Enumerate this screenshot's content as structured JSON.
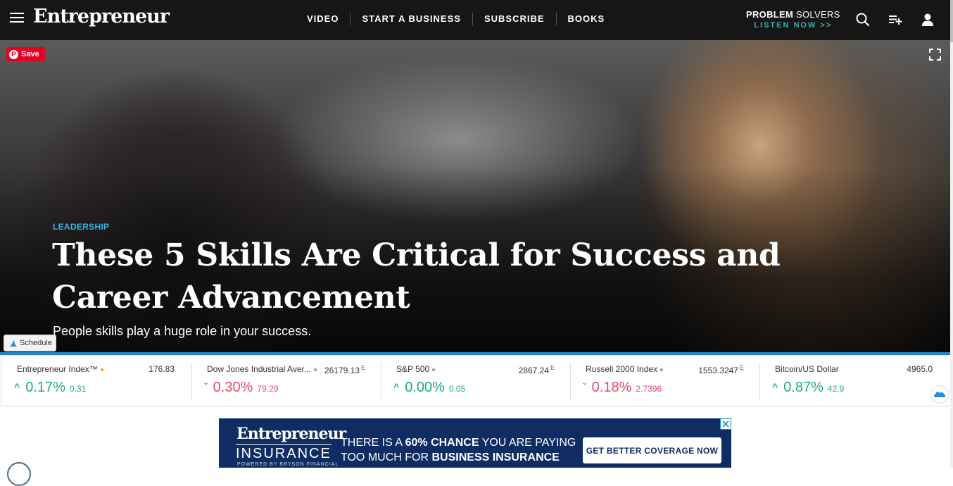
{
  "header": {
    "brand": "Entrepreneur",
    "nav": [
      "VIDEO",
      "START A BUSINESS",
      "SUBSCRIBE",
      "BOOKS"
    ],
    "podcast": {
      "title_bold": "PROBLEM",
      "title_rest": " SOLVERS",
      "cta": "LISTEN NOW >>"
    },
    "icons": [
      "menu-icon",
      "search-icon",
      "playlist-add-icon",
      "user-icon"
    ]
  },
  "hero": {
    "pin_label": "Save",
    "category": "LEADERSHIP",
    "headline": "These 5 Skills Are Critical for Success and Career Advancement",
    "dek": "People skills play a huge role in your success.",
    "schedule_label": "Schedule"
  },
  "ticker": [
    {
      "name": "Entrepreneur Index™",
      "dot_color": "#f39a3c",
      "price": "176.83",
      "e": "",
      "direction": "up",
      "pct": "0.17%",
      "change": "0.31"
    },
    {
      "name": "Dow Jones Industrial Aver...",
      "dot_color": "#999999",
      "price": "26179.13",
      "e": "E",
      "direction": "down",
      "pct": "0.30%",
      "change": "79.29"
    },
    {
      "name": "S&P 500",
      "dot_color": "#999999",
      "price": "2867.24",
      "e": "E",
      "direction": "up",
      "pct": "0.00%",
      "change": "0.05"
    },
    {
      "name": "Russell 2000 Index",
      "dot_color": "#999999",
      "price": "1553.3247",
      "e": "E",
      "direction": "down",
      "pct": "0.18%",
      "change": "2.7396"
    },
    {
      "name": "Bitcoin/US Dollar",
      "dot_color": "",
      "price": "4965.0",
      "e": "",
      "direction": "up",
      "pct": "0.87%",
      "change": "42.9"
    }
  ],
  "ad": {
    "brand": "Entrepreneur",
    "product": "INSURANCE",
    "byline": "POWERED BY BRYSON FINANCIAL",
    "copy_1a": "THERE IS A ",
    "copy_1b": "60% CHANCE",
    "copy_1c": " YOU ARE PAYING",
    "copy_2a": "TOO MUCH FOR ",
    "copy_2b": "BUSINESS INSURANCE",
    "cta": "GET BETTER COVERAGE NOW"
  },
  "colors": {
    "accent": "#1e88c8",
    "up": "#1fa980",
    "down": "#e34a6b",
    "topbar": "#161616",
    "ad_bg": "#0f2d63"
  }
}
